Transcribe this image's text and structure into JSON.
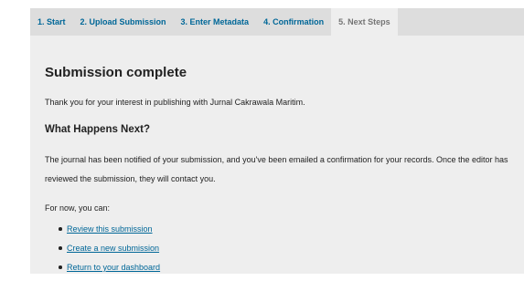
{
  "tabs": [
    {
      "label": "1. Start"
    },
    {
      "label": "2. Upload Submission"
    },
    {
      "label": "3. Enter Metadata"
    },
    {
      "label": "4. Confirmation"
    },
    {
      "label": "5. Next Steps",
      "active": true
    }
  ],
  "main": {
    "title": "Submission complete",
    "thanks": "Thank you for your interest in publishing with Jurnal Cakrawala Maritim.",
    "next_heading": "What Happens Next?",
    "next_body": "The journal has been notified of your submission, and you've been emailed a confirmation for your records. Once the editor has reviewed the submission, they will contact you.",
    "for_now": "For now, you can:",
    "links": [
      {
        "label": "Review this submission"
      },
      {
        "label": "Create a new submission"
      },
      {
        "label": "Return to your dashboard"
      }
    ]
  },
  "colors": {
    "link": "#006798",
    "tab_bar": "#dddddd",
    "panel": "#eeeeee",
    "active_tab_text": "#757575"
  }
}
